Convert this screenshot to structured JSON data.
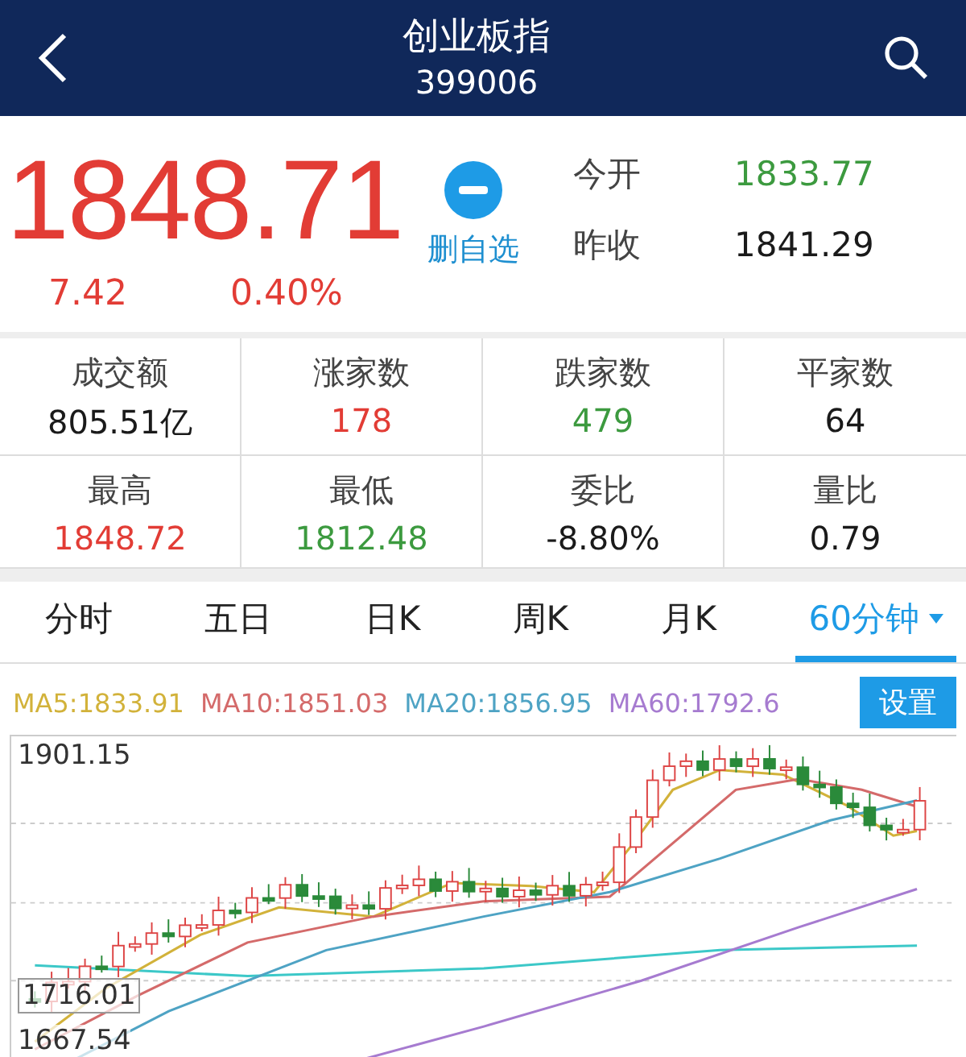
{
  "header": {
    "title": "创业板指",
    "code": "399006"
  },
  "quote": {
    "price": "1848.71",
    "color": "#e23c35",
    "change": "7.42",
    "change_percent": "0.40%",
    "watchlist_action": "删自选"
  },
  "open_close": [
    {
      "label": "今开",
      "value": "1833.77",
      "color": "#3c9a3f"
    },
    {
      "label": "昨收",
      "value": "1841.29",
      "color": "#1a1a1a"
    }
  ],
  "stats": [
    {
      "label": "成交额",
      "value": "805.51亿",
      "color": "#1a1a1a"
    },
    {
      "label": "涨家数",
      "value": "178",
      "color": "#e23c35"
    },
    {
      "label": "跌家数",
      "value": "479",
      "color": "#3c9a3f"
    },
    {
      "label": "平家数",
      "value": "64",
      "color": "#1a1a1a"
    },
    {
      "label": "最高",
      "value": "1848.72",
      "color": "#e23c35"
    },
    {
      "label": "最低",
      "value": "1812.48",
      "color": "#3c9a3f"
    },
    {
      "label": "委比",
      "value": "-8.80%",
      "color": "#1a1a1a"
    },
    {
      "label": "量比",
      "value": "0.79",
      "color": "#1a1a1a"
    }
  ],
  "tabs": [
    {
      "label": "分时",
      "selected": false,
      "dropdown": false
    },
    {
      "label": "五日",
      "selected": false,
      "dropdown": false
    },
    {
      "label": "日K",
      "selected": false,
      "dropdown": false
    },
    {
      "label": "周K",
      "selected": false,
      "dropdown": false
    },
    {
      "label": "月K",
      "selected": false,
      "dropdown": false
    },
    {
      "label": "60分钟",
      "selected": true,
      "dropdown": true
    }
  ],
  "chart": {
    "ma_legend": [
      {
        "text": "MA5:1833.91",
        "color": "#d2b23a"
      },
      {
        "text": "MA10:1851.03",
        "color": "#d46a6a"
      },
      {
        "text": "MA20:1856.95",
        "color": "#4ea3c4"
      },
      {
        "text": "MA60:1792.6",
        "color": "#a67bd0"
      }
    ],
    "settings_button": "设置",
    "y_labels": [
      {
        "text": "1901.15",
        "boxed": false
      },
      {
        "text": "1716.01",
        "boxed": true
      },
      {
        "text": "1667.54",
        "boxed": false
      }
    ]
  }
}
